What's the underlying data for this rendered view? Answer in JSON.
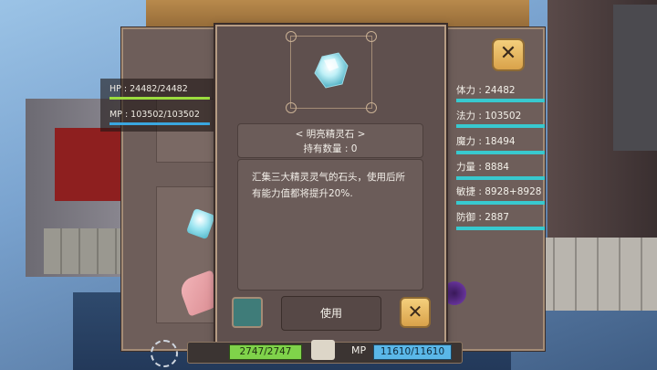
{
  "left_stats": {
    "hp": "HP : 24482/24482",
    "mp": "MP : 103502/103502"
  },
  "right_stats": [
    {
      "label": "体力 : 24482"
    },
    {
      "label": "法力 : 103502"
    },
    {
      "label": "魔力 : 18494"
    },
    {
      "label": "力量 : 8884"
    },
    {
      "label": "敏捷 : 8928+8928"
    },
    {
      "label": "防御 : 2887"
    }
  ],
  "dialog": {
    "item_name": "< 明亮精灵石 >",
    "owned": "持有数量 : 0",
    "description": "汇集三大精灵灵气的石头，使用后所有能力值都将提升20%.",
    "use_label": "使用",
    "close_label": "✕"
  },
  "top_close_label": "✕",
  "hud": {
    "hp": "2747/2747",
    "mp_label": "MP",
    "mp": "11610/11610"
  },
  "colors": {
    "hp_bar": "#9bdc3e",
    "mp_bar": "#3aa7e0",
    "stat_bar": "#38c9cf",
    "close_button": "#e9b85d",
    "panel": "#5f504e"
  }
}
